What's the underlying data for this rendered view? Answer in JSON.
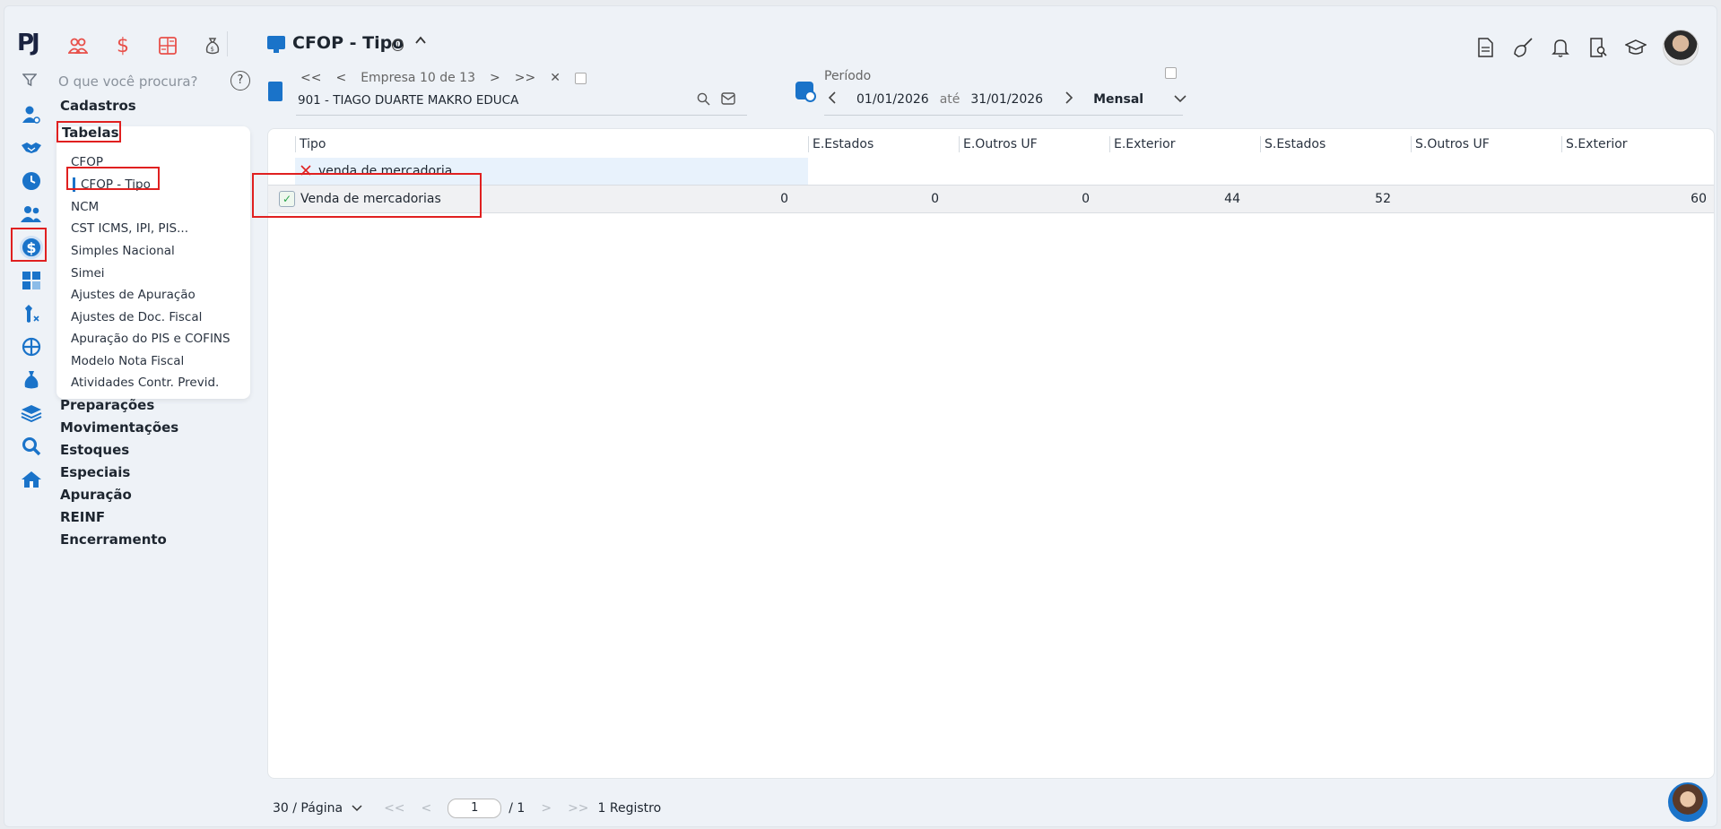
{
  "app": {
    "logo": "PJ"
  },
  "modules": {
    "icons": [
      "people-icon",
      "dollar-icon",
      "calculator-icon",
      "money-bag-icon"
    ],
    "dollar": "$"
  },
  "search": {
    "placeholder": "O que você procura?",
    "help": "?"
  },
  "menu": {
    "sections_top": [
      "Cadastros",
      "Tabelas"
    ],
    "submenu": [
      "CFOP",
      "CFOP - Tipo",
      "NCM",
      "CST ICMS, IPI, PIS...",
      "Simples Nacional",
      "Simei",
      "Ajustes de Apuração",
      "Ajustes de Doc. Fiscal",
      "Apuração do PIS e COFINS",
      "Modelo Nota Fiscal",
      "Atividades Contr. Previd."
    ],
    "sections_bottom": [
      "Preparações",
      "Movimentações",
      "Estoques",
      "Especiais",
      "Apuração",
      "REINF",
      "Encerramento"
    ]
  },
  "header": {
    "title": "CFOP - Tipo",
    "info": "i"
  },
  "empresa": {
    "first": "<<",
    "prev": "<",
    "label": "Empresa 10 de 13",
    "next": ">",
    "last": ">>",
    "clear": "✕",
    "name": "901 - TIAGO DUARTE MAKRO EDUCA"
  },
  "periodo": {
    "label": "Período",
    "start": "01/01/2026",
    "sep": "até",
    "end": "31/01/2026",
    "mode": "Mensal"
  },
  "grid": {
    "columns": [
      "Tipo",
      "E.Estados",
      "E.Outros UF",
      "E.Exterior",
      "S.Estados",
      "S.Outros UF",
      "S.Exterior"
    ],
    "filter_value": "venda de mercadoria",
    "rows": [
      {
        "tipo": "Venda de mercadorias",
        "e_estados": "0",
        "e_outros_uf": "0",
        "e_exterior": "0",
        "s_estados": "44",
        "s_outros_uf": "52",
        "s_exterior": "60"
      }
    ]
  },
  "pager": {
    "page_size": "30 / Página",
    "first": "<<",
    "prev": "<",
    "page": "1",
    "total": "/ 1",
    "next": ">",
    "last": ">>",
    "records": "1 Registro"
  },
  "colors": {
    "accent": "#1a73c9",
    "highlight": "#e02020",
    "module": "#e8504a"
  }
}
